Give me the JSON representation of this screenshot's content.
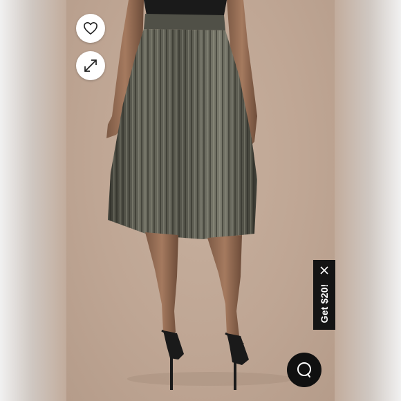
{
  "promo": {
    "label": "Get $20!"
  },
  "icons": {
    "favorite": "heart-icon",
    "expand": "expand-icon",
    "close": "close-icon",
    "chat": "chat-bubble-icon"
  },
  "colors": {
    "background": "#c2ac9c",
    "skirt": "#4a4a40",
    "promo_bg": "#141414",
    "chat_bg": "#101010"
  }
}
